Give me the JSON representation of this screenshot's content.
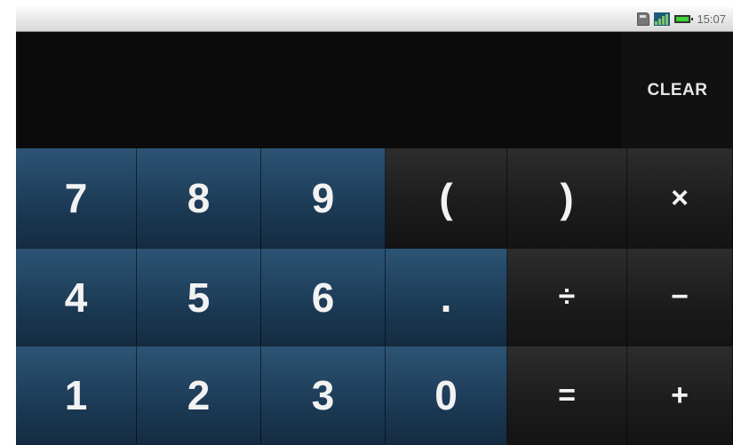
{
  "status_bar": {
    "time": "15:07",
    "icons": [
      "sd-card-icon",
      "signal-icon",
      "battery-icon"
    ]
  },
  "display": {
    "clear_label": "CLEAR"
  },
  "keys": {
    "k7": "7",
    "k8": "8",
    "k9": "9",
    "lparen": "(",
    "rparen": ")",
    "multiply": "×",
    "k4": "4",
    "k5": "5",
    "k6": "6",
    "dot": ".",
    "divide": "÷",
    "minus": "−",
    "k1": "1",
    "k2": "2",
    "k3": "3",
    "k0": "0",
    "equals": "=",
    "plus": "+"
  },
  "colors": {
    "digit_key": "#1f3f5c",
    "operator_key": "#1b1b1b",
    "display_bg": "#0b0b0b",
    "key_text": "#f2f2f2"
  }
}
